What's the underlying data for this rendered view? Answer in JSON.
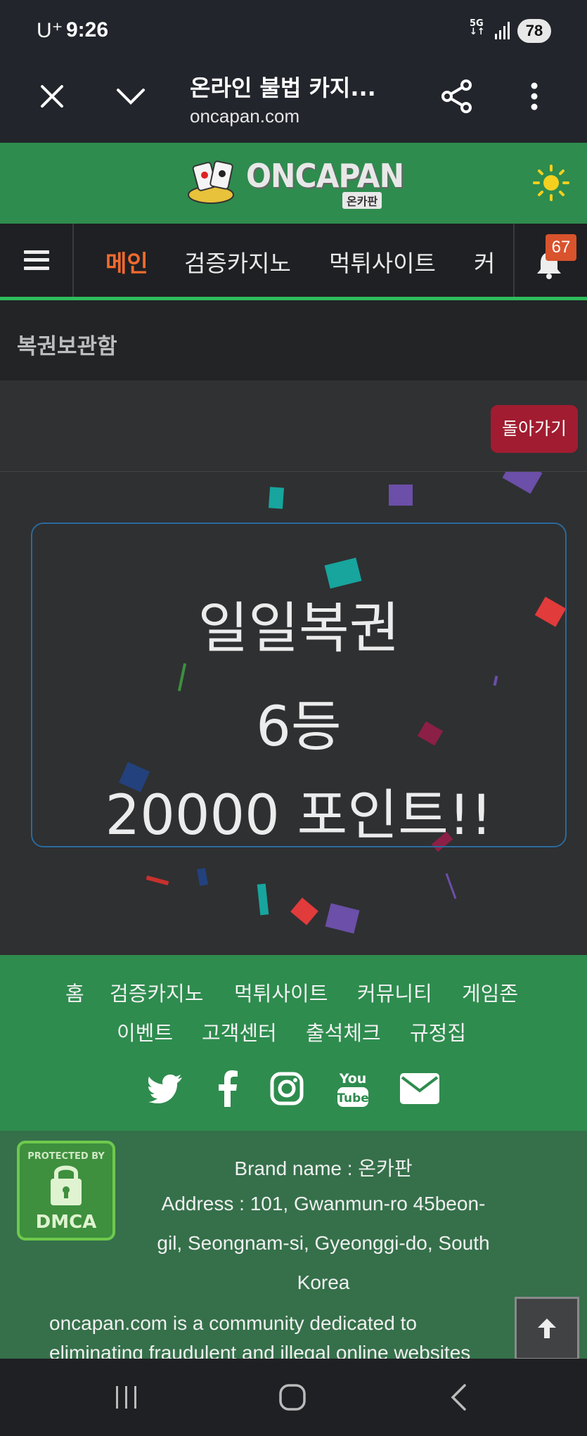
{
  "status_bar": {
    "carrier": "U⁺",
    "time": "9:26",
    "network": "5G",
    "battery": "78"
  },
  "browser": {
    "page_title": "온라인 불법 카지...",
    "url": "oncapan.com"
  },
  "site": {
    "logo_text": "ONCAPAN",
    "logo_subtext": "온카판"
  },
  "nav": {
    "items": [
      "메인",
      "검증카지노",
      "먹튀사이트",
      "커"
    ],
    "notification_count": "67"
  },
  "section": {
    "title": "복권보관함",
    "back_label": "돌아가기"
  },
  "result": {
    "lines": [
      "일일복권",
      "6등",
      "20000 포인트!!"
    ]
  },
  "footer_nav": {
    "row1": [
      "홈",
      "검증카지노",
      "먹튀사이트",
      "커뮤니티",
      "게임존"
    ],
    "row2": [
      "이벤트",
      "고객센터",
      "출석체크",
      "규정집"
    ],
    "social_icons": [
      "twitter-icon",
      "facebook-icon",
      "instagram-icon",
      "youtube-icon",
      "mail-icon"
    ]
  },
  "footer_info": {
    "dmca_top": "PROTECTED BY",
    "dmca_bottom": "DMCA",
    "brand": "Brand name : 온카판",
    "address_1": "Address : 101, Gwanmun-ro 45beon-",
    "address_2": "gil, Seongnam-si, Gyeonggi-do, South",
    "address_3": "Korea",
    "desc_1": "oncapan.com is a community dedicated to",
    "desc_2": "eliminating fraudulent and illegal online websites"
  },
  "colors": {
    "green": "#2e8c4e",
    "accent_orange": "#f06a2e",
    "back_red": "#a11c30",
    "badge": "#d9532d"
  }
}
